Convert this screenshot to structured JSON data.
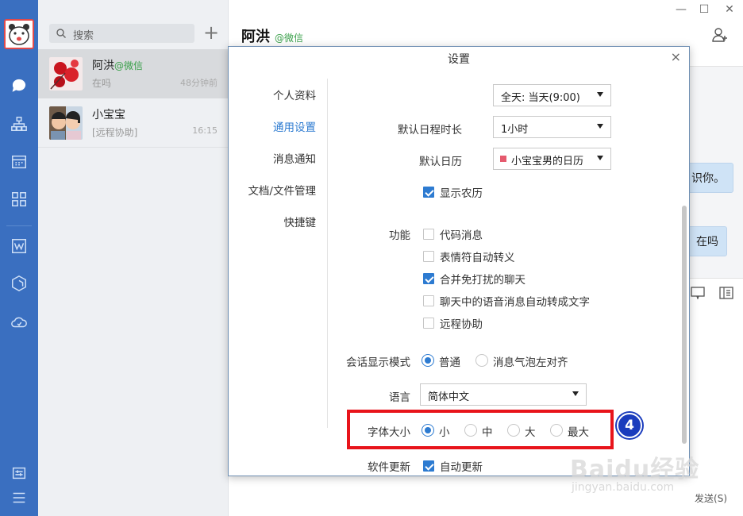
{
  "nav": {
    "icons": [
      "chat-icon",
      "contacts-icon",
      "calendar-icon",
      "apps-icon",
      "document-icon",
      "box-icon",
      "cloud-icon",
      "settings-icon",
      "menu-icon"
    ]
  },
  "search": {
    "placeholder": "搜索"
  },
  "chats": [
    {
      "name": "阿洪",
      "source": "@微信",
      "preview": "在吗",
      "time": "48分钟前"
    },
    {
      "name": "小宝宝",
      "preview": "[远程协助]",
      "time": "16:15"
    }
  ],
  "chat": {
    "title": "阿洪",
    "source": "@微信",
    "bubbles": [
      "识你。",
      "在吗"
    ],
    "send_label": "发送(S)"
  },
  "window": {
    "minimize": "—",
    "maximize": "☐",
    "close": "✕"
  },
  "dialog": {
    "title": "设置",
    "close": "×",
    "sidebar": [
      "个人资料",
      "通用设置",
      "消息通知",
      "文档/文件管理",
      "快捷键"
    ],
    "active_index": 1,
    "allday_value": "全天: 当天(9:00)",
    "duration_label": "默认日程时长",
    "duration_value": "1小时",
    "calendar_label": "默认日历",
    "calendar_value": "小宝宝男的日历",
    "calendar_color": "#e55a6e",
    "lunar_label": "显示农历",
    "lunar_checked": true,
    "features_label": "功能",
    "features": [
      {
        "label": "代码消息",
        "checked": false
      },
      {
        "label": "表情符自动转义",
        "checked": false
      },
      {
        "label": "合并免打扰的聊天",
        "checked": true
      },
      {
        "label": "聊天中的语音消息自动转成文字",
        "checked": false
      },
      {
        "label": "远程协助",
        "checked": false
      }
    ],
    "mode_label": "会话显示模式",
    "mode_options": [
      "普通",
      "消息气泡左对齐"
    ],
    "mode_selected": 0,
    "language_label": "语言",
    "language_value": "简体中文",
    "fontsize_label": "字体大小",
    "fontsize_options": [
      "小",
      "中",
      "大",
      "最大"
    ],
    "fontsize_selected": 0,
    "update_label": "软件更新",
    "update_option": "自动更新",
    "update_checked": true
  },
  "annotation": {
    "badge": "4",
    "highlight_color": "#e8141b"
  },
  "watermark": {
    "brand": "Baidu经验",
    "url": "jingyan.baidu.com"
  },
  "colors": {
    "accent": "#2d7bd1",
    "nav_bg": "#3a6fc0",
    "wechat_green": "#3aa04a"
  }
}
